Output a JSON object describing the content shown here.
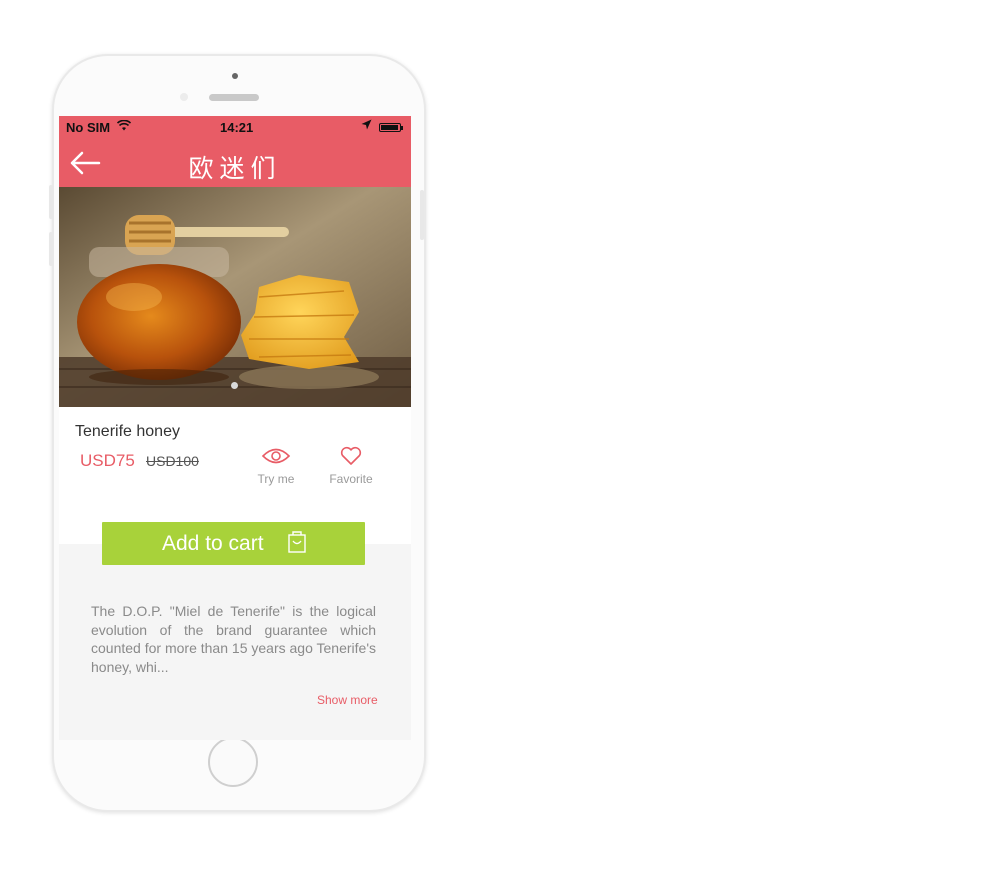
{
  "status_bar": {
    "carrier": "No SIM",
    "time": "14:21"
  },
  "header": {
    "title": "欧迷们"
  },
  "product": {
    "name": "Tenerife honey",
    "price": "USD75",
    "old_price": "USD100"
  },
  "actions": {
    "try_label": "Try me",
    "favorite_label": "Favorite"
  },
  "cart_button": {
    "label": "Add to cart"
  },
  "description": {
    "text": "The D.O.P. \"Miel de Tenerife\" is the logical evolution of the brand guarantee which counted for more than 15 years ago Tenerife's honey, whi...",
    "show_more": "Show more"
  },
  "colors": {
    "accent": "#e85c66",
    "cart": "#a8d23a",
    "desc_bg": "#f5f5f5"
  },
  "icons": [
    "back-arrow-icon",
    "wifi-icon",
    "location-icon",
    "battery-icon",
    "eye-icon",
    "heart-icon",
    "shopping-bag-icon"
  ]
}
